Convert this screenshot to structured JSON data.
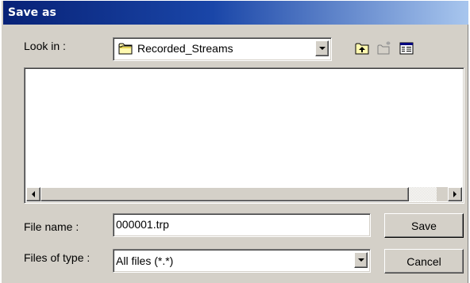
{
  "dialog": {
    "title": "Save as"
  },
  "look_in": {
    "label": "Look in :",
    "folder": "Recorded_Streams",
    "folder_icon": "folder-icon"
  },
  "toolbar": {
    "up_icon": "up-one-level-icon",
    "new_folder_icon": "new-folder-icon",
    "view_icon": "details-view-icon"
  },
  "file_list": {
    "items": []
  },
  "file_name": {
    "label": "File name :",
    "value": "000001.trp"
  },
  "file_type": {
    "label": "Files of type :",
    "value": "All files (*.*)"
  },
  "buttons": {
    "save": "Save",
    "cancel": "Cancel"
  },
  "colors": {
    "title_bar_start": "#082277",
    "title_bar_end": "#a8c6ee",
    "face": "#d4d0c8"
  }
}
